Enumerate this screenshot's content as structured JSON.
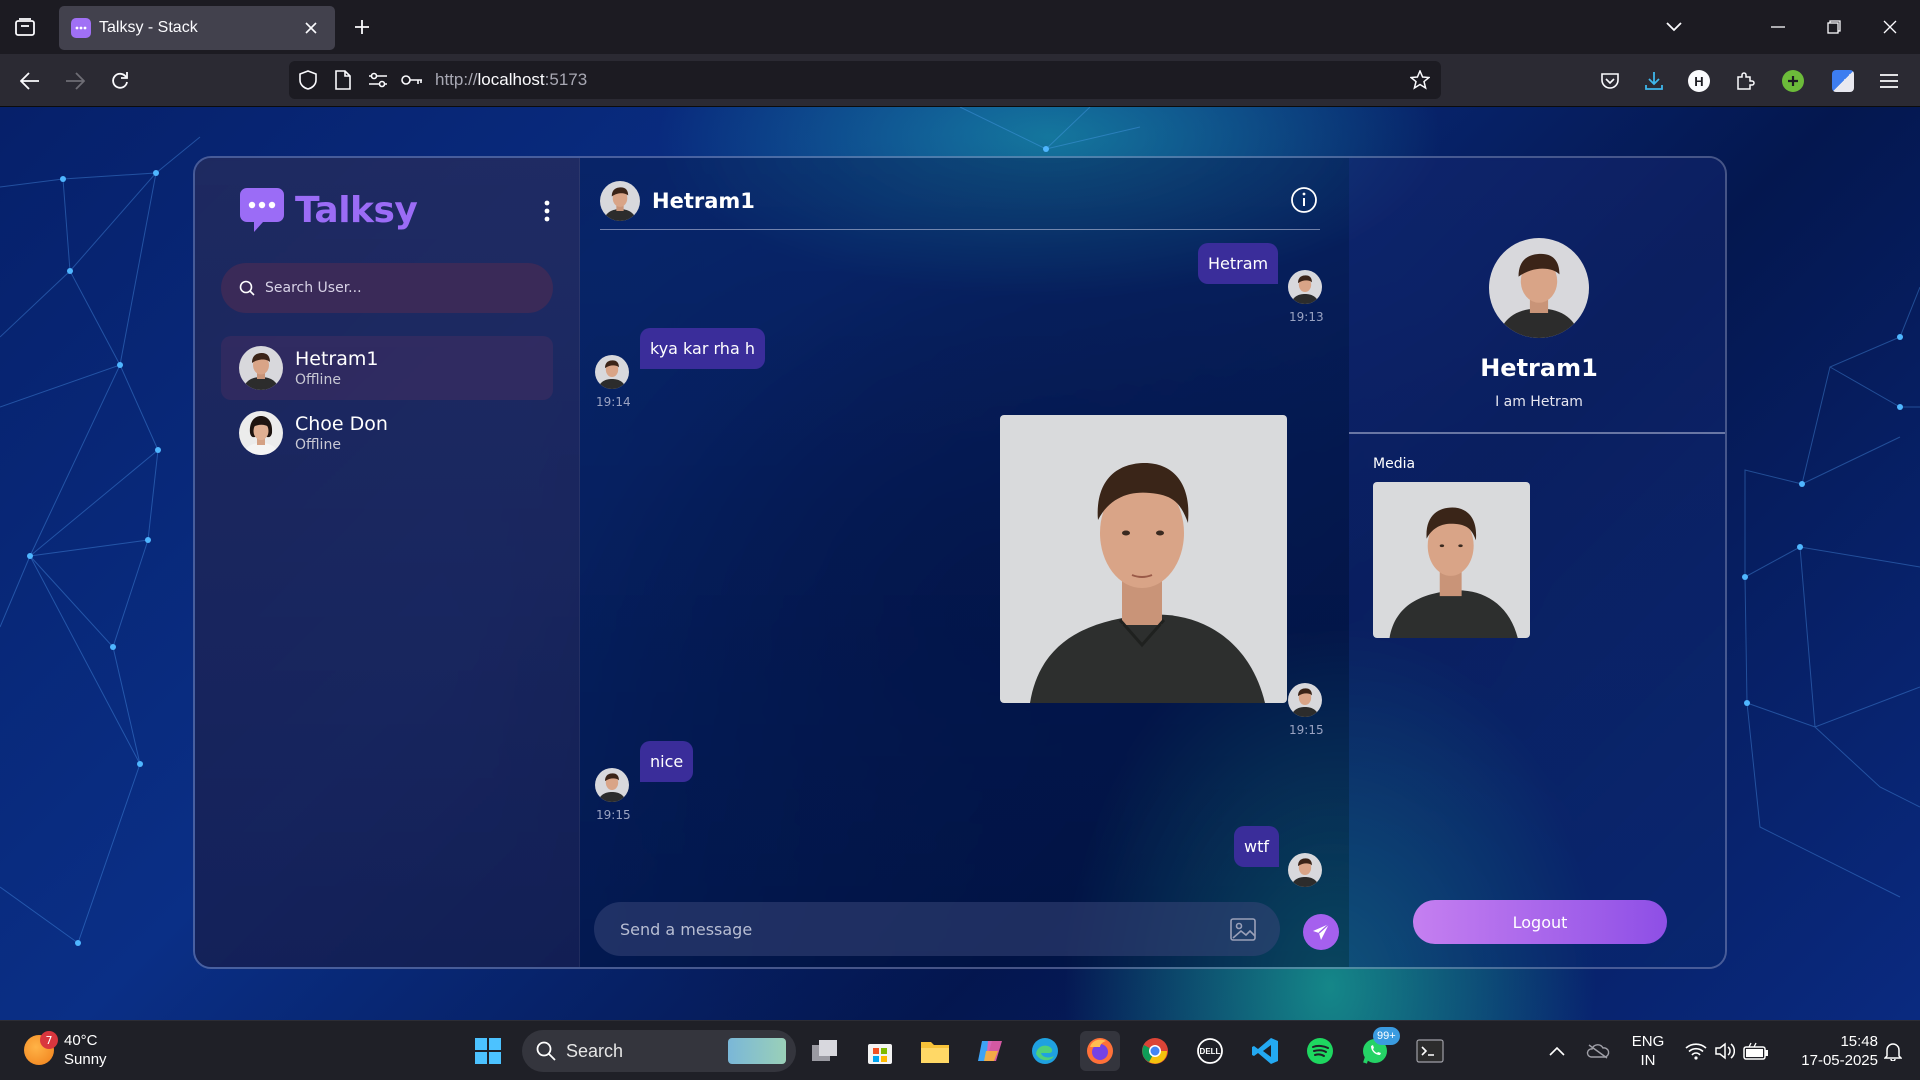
{
  "browser": {
    "tab_title": "Talksy - Stack",
    "url_prefix": "http://",
    "url_host": "localhost",
    "url_port": ":5173"
  },
  "app": {
    "logo_text": "Talksy",
    "search_placeholder": "Search User...",
    "users": [
      {
        "name": "Hetram1",
        "status": "Offline"
      },
      {
        "name": "Choe Don",
        "status": "Offline"
      }
    ],
    "chat": {
      "title": "Hetram1",
      "messages": [
        {
          "type": "text",
          "side": "sent",
          "text": "Hetram",
          "time": "19:13"
        },
        {
          "type": "text",
          "side": "recv",
          "text": "kya kar rha h",
          "time": "19:14"
        },
        {
          "type": "image",
          "side": "sent",
          "time": "19:15"
        },
        {
          "type": "text",
          "side": "recv",
          "text": "nice",
          "time": "19:15"
        },
        {
          "type": "text",
          "side": "sent",
          "text": "wtf",
          "time": ""
        }
      ],
      "composer_placeholder": "Send a message"
    },
    "details": {
      "name": "Hetram1",
      "bio": "I am Hetram",
      "media_label": "Media",
      "logout_label": "Logout"
    }
  },
  "colors": {
    "accent": "#9b6cf6",
    "bubble": "#3a2d9a",
    "send_button": "#a560ee"
  },
  "taskbar": {
    "weather_temp": "40°C",
    "weather_desc": "Sunny",
    "weather_badge": "7",
    "search_label": "Search",
    "whatsapp_badge": "99+",
    "lang_line1": "ENG",
    "lang_line2": "IN",
    "time": "15:48",
    "date": "17-05-2025"
  }
}
